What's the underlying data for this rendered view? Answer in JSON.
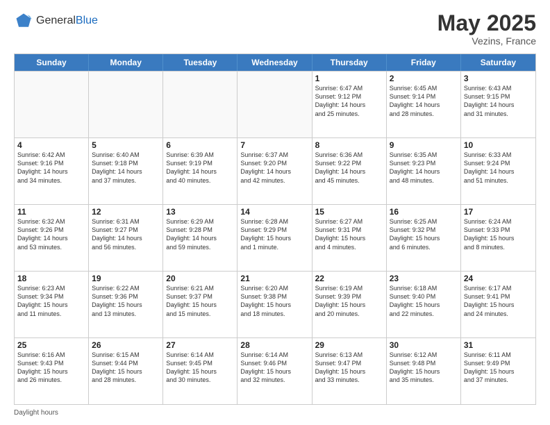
{
  "logo": {
    "general": "General",
    "blue": "Blue"
  },
  "title": "May 2025",
  "location": "Vezins, France",
  "days": [
    "Sunday",
    "Monday",
    "Tuesday",
    "Wednesday",
    "Thursday",
    "Friday",
    "Saturday"
  ],
  "footer": "Daylight hours",
  "weeks": [
    [
      {
        "day": "",
        "detail": ""
      },
      {
        "day": "",
        "detail": ""
      },
      {
        "day": "",
        "detail": ""
      },
      {
        "day": "",
        "detail": ""
      },
      {
        "day": "1",
        "detail": "Sunrise: 6:47 AM\nSunset: 9:12 PM\nDaylight: 14 hours\nand 25 minutes."
      },
      {
        "day": "2",
        "detail": "Sunrise: 6:45 AM\nSunset: 9:14 PM\nDaylight: 14 hours\nand 28 minutes."
      },
      {
        "day": "3",
        "detail": "Sunrise: 6:43 AM\nSunset: 9:15 PM\nDaylight: 14 hours\nand 31 minutes."
      }
    ],
    [
      {
        "day": "4",
        "detail": "Sunrise: 6:42 AM\nSunset: 9:16 PM\nDaylight: 14 hours\nand 34 minutes."
      },
      {
        "day": "5",
        "detail": "Sunrise: 6:40 AM\nSunset: 9:18 PM\nDaylight: 14 hours\nand 37 minutes."
      },
      {
        "day": "6",
        "detail": "Sunrise: 6:39 AM\nSunset: 9:19 PM\nDaylight: 14 hours\nand 40 minutes."
      },
      {
        "day": "7",
        "detail": "Sunrise: 6:37 AM\nSunset: 9:20 PM\nDaylight: 14 hours\nand 42 minutes."
      },
      {
        "day": "8",
        "detail": "Sunrise: 6:36 AM\nSunset: 9:22 PM\nDaylight: 14 hours\nand 45 minutes."
      },
      {
        "day": "9",
        "detail": "Sunrise: 6:35 AM\nSunset: 9:23 PM\nDaylight: 14 hours\nand 48 minutes."
      },
      {
        "day": "10",
        "detail": "Sunrise: 6:33 AM\nSunset: 9:24 PM\nDaylight: 14 hours\nand 51 minutes."
      }
    ],
    [
      {
        "day": "11",
        "detail": "Sunrise: 6:32 AM\nSunset: 9:26 PM\nDaylight: 14 hours\nand 53 minutes."
      },
      {
        "day": "12",
        "detail": "Sunrise: 6:31 AM\nSunset: 9:27 PM\nDaylight: 14 hours\nand 56 minutes."
      },
      {
        "day": "13",
        "detail": "Sunrise: 6:29 AM\nSunset: 9:28 PM\nDaylight: 14 hours\nand 59 minutes."
      },
      {
        "day": "14",
        "detail": "Sunrise: 6:28 AM\nSunset: 9:29 PM\nDaylight: 15 hours\nand 1 minute."
      },
      {
        "day": "15",
        "detail": "Sunrise: 6:27 AM\nSunset: 9:31 PM\nDaylight: 15 hours\nand 4 minutes."
      },
      {
        "day": "16",
        "detail": "Sunrise: 6:25 AM\nSunset: 9:32 PM\nDaylight: 15 hours\nand 6 minutes."
      },
      {
        "day": "17",
        "detail": "Sunrise: 6:24 AM\nSunset: 9:33 PM\nDaylight: 15 hours\nand 8 minutes."
      }
    ],
    [
      {
        "day": "18",
        "detail": "Sunrise: 6:23 AM\nSunset: 9:34 PM\nDaylight: 15 hours\nand 11 minutes."
      },
      {
        "day": "19",
        "detail": "Sunrise: 6:22 AM\nSunset: 9:36 PM\nDaylight: 15 hours\nand 13 minutes."
      },
      {
        "day": "20",
        "detail": "Sunrise: 6:21 AM\nSunset: 9:37 PM\nDaylight: 15 hours\nand 15 minutes."
      },
      {
        "day": "21",
        "detail": "Sunrise: 6:20 AM\nSunset: 9:38 PM\nDaylight: 15 hours\nand 18 minutes."
      },
      {
        "day": "22",
        "detail": "Sunrise: 6:19 AM\nSunset: 9:39 PM\nDaylight: 15 hours\nand 20 minutes."
      },
      {
        "day": "23",
        "detail": "Sunrise: 6:18 AM\nSunset: 9:40 PM\nDaylight: 15 hours\nand 22 minutes."
      },
      {
        "day": "24",
        "detail": "Sunrise: 6:17 AM\nSunset: 9:41 PM\nDaylight: 15 hours\nand 24 minutes."
      }
    ],
    [
      {
        "day": "25",
        "detail": "Sunrise: 6:16 AM\nSunset: 9:43 PM\nDaylight: 15 hours\nand 26 minutes."
      },
      {
        "day": "26",
        "detail": "Sunrise: 6:15 AM\nSunset: 9:44 PM\nDaylight: 15 hours\nand 28 minutes."
      },
      {
        "day": "27",
        "detail": "Sunrise: 6:14 AM\nSunset: 9:45 PM\nDaylight: 15 hours\nand 30 minutes."
      },
      {
        "day": "28",
        "detail": "Sunrise: 6:14 AM\nSunset: 9:46 PM\nDaylight: 15 hours\nand 32 minutes."
      },
      {
        "day": "29",
        "detail": "Sunrise: 6:13 AM\nSunset: 9:47 PM\nDaylight: 15 hours\nand 33 minutes."
      },
      {
        "day": "30",
        "detail": "Sunrise: 6:12 AM\nSunset: 9:48 PM\nDaylight: 15 hours\nand 35 minutes."
      },
      {
        "day": "31",
        "detail": "Sunrise: 6:11 AM\nSunset: 9:49 PM\nDaylight: 15 hours\nand 37 minutes."
      }
    ]
  ]
}
